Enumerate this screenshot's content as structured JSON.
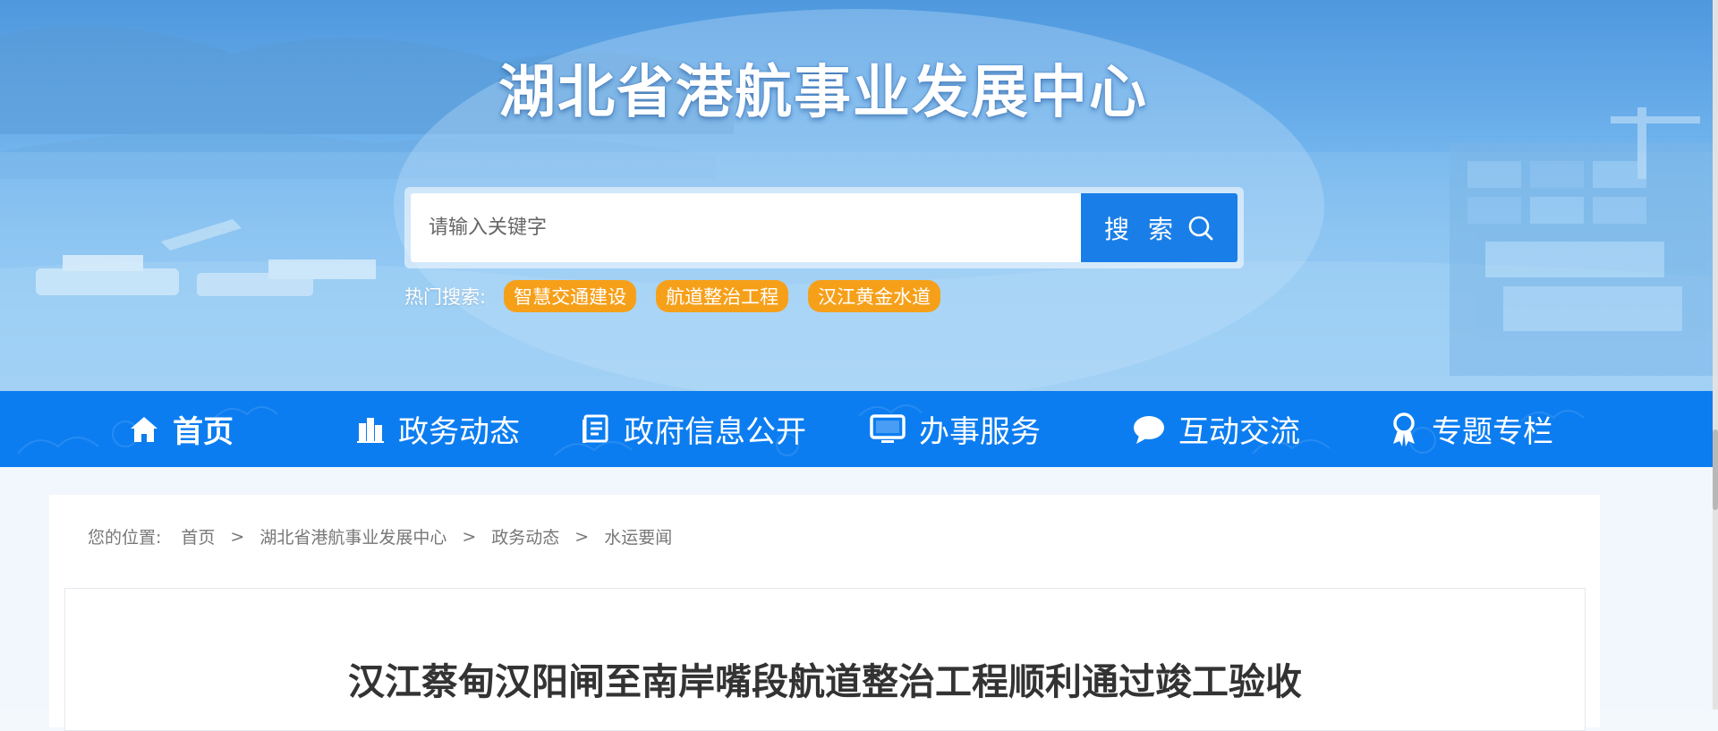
{
  "header": {
    "site_title": "湖北省港航事业发展中心"
  },
  "search": {
    "placeholder": "请输入关键字",
    "button_label": "搜 索",
    "button_icon": "search-icon"
  },
  "hot_search": {
    "label": "热门搜索:",
    "tags": [
      "智慧交通建设",
      "航道整治工程",
      "汉江黄金水道"
    ]
  },
  "nav": {
    "items": [
      {
        "label": "首页",
        "icon": "home-icon"
      },
      {
        "label": "政务动态",
        "icon": "building-icon"
      },
      {
        "label": "政府信息公开",
        "icon": "document-icon"
      },
      {
        "label": "办事服务",
        "icon": "monitor-icon"
      },
      {
        "label": "互动交流",
        "icon": "chat-bubble-icon"
      },
      {
        "label": "专题专栏",
        "icon": "award-icon"
      }
    ]
  },
  "breadcrumb": {
    "label": "您的位置:",
    "items": [
      "首页",
      "湖北省港航事业发展中心",
      "政务动态",
      "水运要闻"
    ],
    "separator": ">"
  },
  "article": {
    "title": "汉江蔡甸汉阳闸至南岸嘴段航道整治工程顺利通过竣工验收"
  },
  "colors": {
    "nav_bg": "#0c7df0",
    "search_button": "#1a7ee8",
    "hot_tag": "#f6a01a"
  }
}
